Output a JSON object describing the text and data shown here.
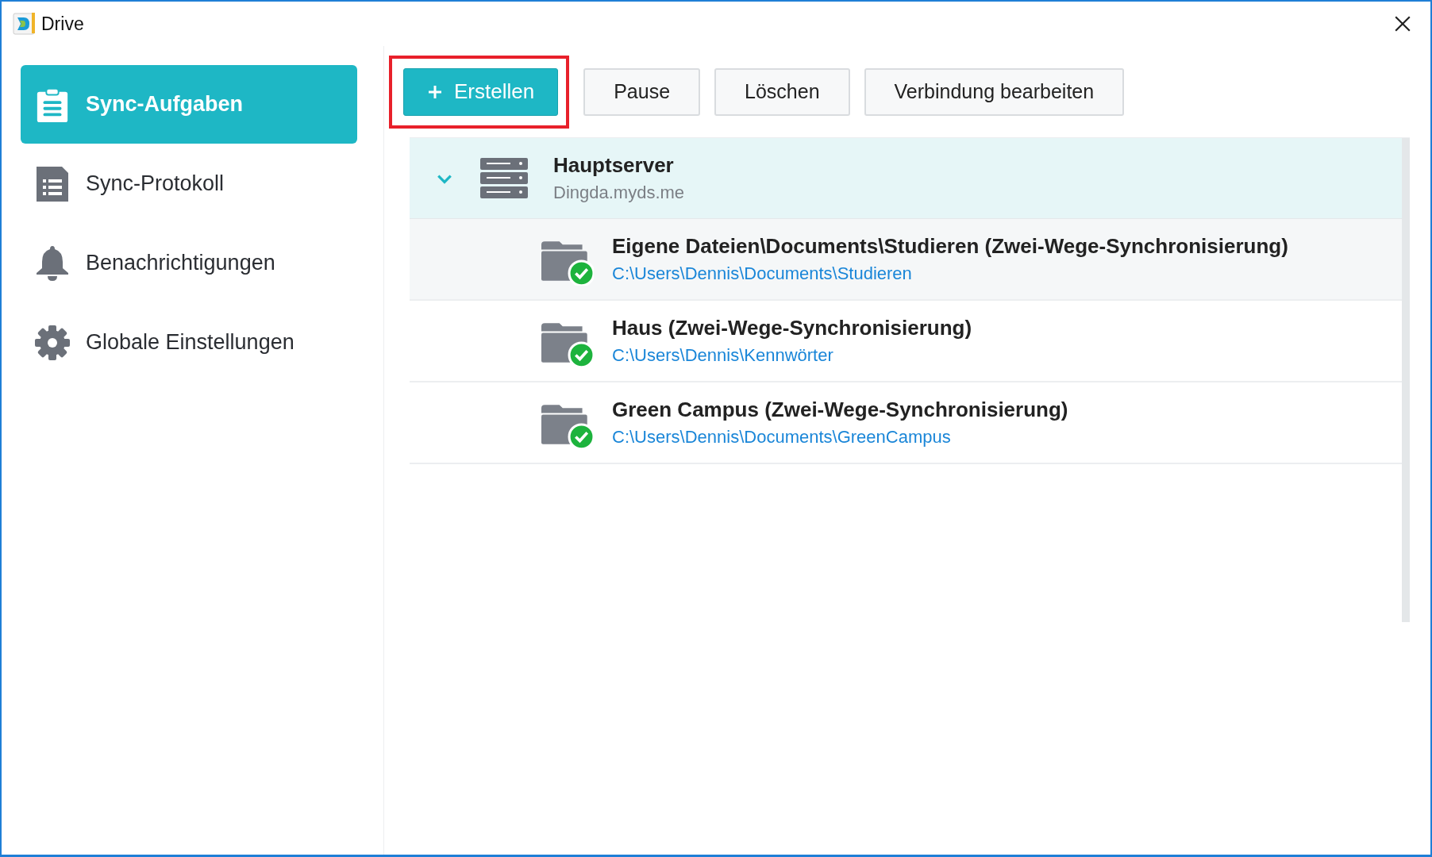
{
  "window": {
    "title": "Drive"
  },
  "sidebar": {
    "items": [
      {
        "label": "Sync-Aufgaben",
        "selected": true
      },
      {
        "label": "Sync-Protokoll",
        "selected": false
      },
      {
        "label": "Benachrichtigungen",
        "selected": false
      },
      {
        "label": "Globale Einstellungen",
        "selected": false
      }
    ]
  },
  "toolbar": {
    "buttons": [
      {
        "label": "Erstellen",
        "kind": "primary",
        "highlighted": true
      },
      {
        "label": "Pause",
        "kind": "default",
        "highlighted": false
      },
      {
        "label": "Löschen",
        "kind": "default",
        "highlighted": false
      },
      {
        "label": "Verbindung bearbeiten",
        "kind": "default",
        "highlighted": false
      }
    ]
  },
  "server": {
    "name": "Hauptserver",
    "address": "Dingda.myds.me",
    "expanded": true,
    "tasks": [
      {
        "title": "Eigene Dateien\\Documents\\Studieren (Zwei-Wege-Synchronisierung)",
        "path": "C:\\Users\\Dennis\\Documents\\Studieren",
        "selected": true,
        "synced": true
      },
      {
        "title": "Haus (Zwei-Wege-Synchronisierung)",
        "path": "C:\\Users\\Dennis\\Kennwörter",
        "selected": false,
        "synced": true
      },
      {
        "title": "Green Campus (Zwei-Wege-Synchronisierung)",
        "path": "C:\\Users\\Dennis\\Documents\\GreenCampus",
        "selected": false,
        "synced": true
      }
    ]
  }
}
